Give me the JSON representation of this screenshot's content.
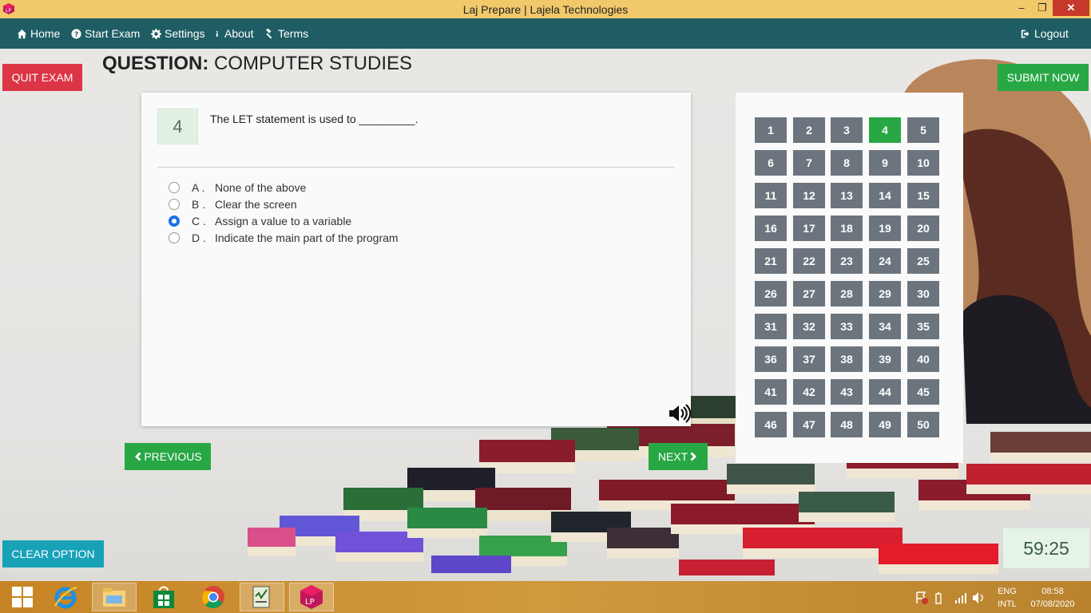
{
  "window": {
    "title": "Laj Prepare | Lajela Technologies",
    "min": "–",
    "max": "❐",
    "close": "✕"
  },
  "nav": {
    "home": "Home",
    "start_exam": "Start Exam",
    "settings": "Settings",
    "about": "About",
    "terms": "Terms",
    "logout": "Logout"
  },
  "exam": {
    "quit_label": "QUIT EXAM",
    "submit_label": "SUBMIT NOW",
    "heading_prefix": "QUESTION:",
    "subject": "COMPUTER STUDIES",
    "question_number": "4",
    "question_text": "The LET statement is used to _________.",
    "options": [
      {
        "letter": "A .",
        "text": "None of the above",
        "checked": false
      },
      {
        "letter": "B .",
        "text": "Clear the screen",
        "checked": false
      },
      {
        "letter": "C .",
        "text": "Assign a value to a variable",
        "checked": true
      },
      {
        "letter": "D .",
        "text": "Indicate the main part of the program",
        "checked": false
      }
    ],
    "previous_label": "PREVIOUS",
    "next_label": "NEXT",
    "clear_label": "CLEAR OPTION",
    "timer": "59:25",
    "current_question": 4,
    "question_numbers": [
      "1",
      "2",
      "3",
      "4",
      "5",
      "6",
      "7",
      "8",
      "9",
      "10",
      "11",
      "12",
      "13",
      "14",
      "15",
      "16",
      "17",
      "18",
      "19",
      "20",
      "21",
      "22",
      "23",
      "24",
      "25",
      "26",
      "27",
      "28",
      "29",
      "30",
      "31",
      "32",
      "33",
      "34",
      "35",
      "36",
      "37",
      "38",
      "39",
      "40",
      "41",
      "42",
      "43",
      "44",
      "45",
      "46",
      "47",
      "48",
      "49",
      "50"
    ]
  },
  "taskbar": {
    "lang_top": "ENG",
    "lang_bottom": "INTL",
    "time": "08:58",
    "date": "07/08/2020"
  },
  "colors": {
    "nav_bg": "#1e5d63",
    "title_bg": "#f2c96a",
    "success": "#28a745",
    "danger": "#dc3545",
    "info": "#17a2b8",
    "secondary": "#6c757d"
  }
}
